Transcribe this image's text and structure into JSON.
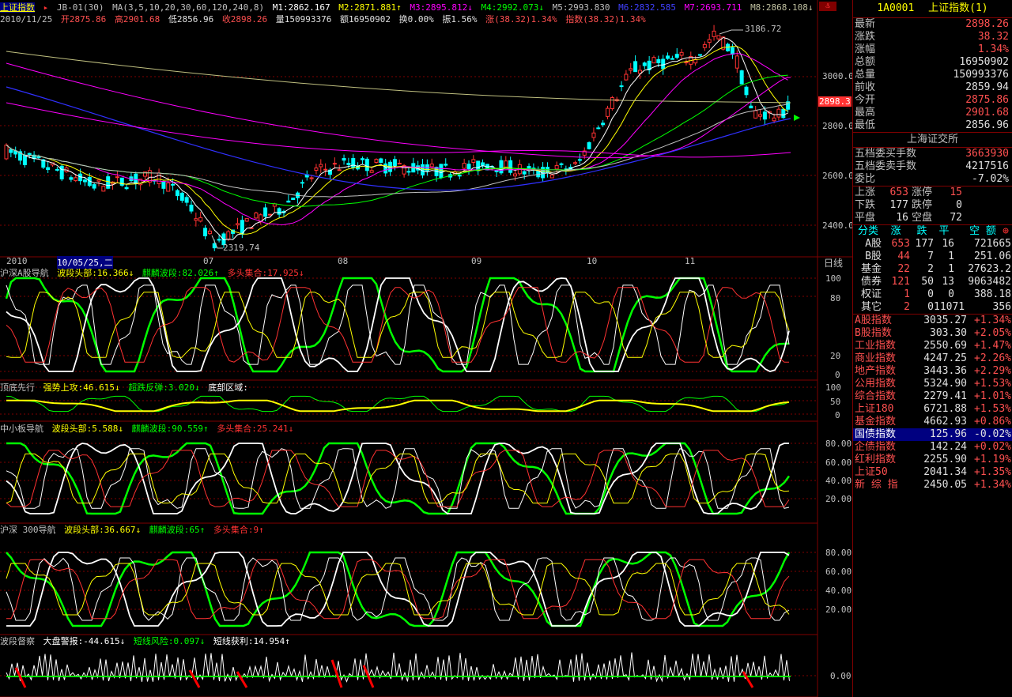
{
  "colors": {
    "up": "#ff3232",
    "down": "#00ffff",
    "ma_white": "#ffffff",
    "ma_yellow": "#ffff00",
    "ma_magenta": "#ff00ff",
    "ma_green": "#00ff00",
    "ma_blue": "#0000ff",
    "grid": "#800000",
    "nav_green": "#00ff00"
  },
  "header": {
    "title": "上证指数",
    "period": "JB-01(30)",
    "ma_label": "MA(3,5,10,20,30,60,120,240,8)",
    "ma_values": [
      "M1:2862.167",
      "M2:2871.881↑",
      "M3:2895.812↓",
      "M4:2992.073↓",
      "M5:2993.830",
      "M6:2832.585",
      "M7:2693.711",
      "M8:2868.108↓"
    ],
    "date": "2010/11/25",
    "open": "开2875.86",
    "high": "高2901.68",
    "low": "低2856.96",
    "close": "收2898.26",
    "volume": "量150993376",
    "amount": "额16950902",
    "turnover": "换0.00%",
    "amplitude": "振1.56%",
    "change": "涨(38.32)1.34%",
    "index_change": "指数(38.32)1.34%"
  },
  "main_chart": {
    "price_labels": [
      "3000.0",
      "2800.0",
      "2600.0",
      "2400.0"
    ],
    "high_label": "3186.72",
    "low_label": "2319.74",
    "current_label": "2898.3",
    "x_labels": [
      "2010",
      "10/05/25,二",
      "07",
      "08",
      "09",
      "10",
      "11"
    ],
    "period_label": "日线"
  },
  "panels": [
    {
      "name": "沪深A股导航",
      "items": [
        {
          "text": "波段头部:16.366↓",
          "color": "#ffff00"
        },
        {
          "text": "麒麟波段:82.026↑",
          "color": "#00ff00"
        },
        {
          "text": "多头集合:17.925↓",
          "color": "#ff3232"
        }
      ],
      "ticks": [
        "100",
        "80",
        "20",
        "0"
      ]
    },
    {
      "name": "顶底先行",
      "items": [
        {
          "text": "强势上攻:46.615↓",
          "color": "#ffff00"
        },
        {
          "text": "超跌反弹:3.020↓",
          "color": "#00ff00"
        },
        {
          "text": "底部区域:",
          "color": "#ffffff"
        }
      ],
      "ticks": [
        "100",
        "50",
        "0"
      ]
    },
    {
      "name": "中小板导航",
      "items": [
        {
          "text": "波段头部:5.588↓",
          "color": "#ffff00"
        },
        {
          "text": "麒麟波段:90.559↑",
          "color": "#00ff00"
        },
        {
          "text": "多头集合:25.241↓",
          "color": "#ff3232"
        }
      ],
      "ticks": [
        "80.00",
        "60.00",
        "40.00",
        "20.00"
      ]
    },
    {
      "name": "沪深 300导航",
      "items": [
        {
          "text": "波段头部:36.667↓",
          "color": "#ffff00"
        },
        {
          "text": "麒麟波段:65↑",
          "color": "#00ff00"
        },
        {
          "text": "多头集合:9↑",
          "color": "#ff3232"
        }
      ],
      "ticks": [
        "80.00",
        "60.00",
        "40.00",
        "20.00"
      ]
    },
    {
      "name": "波段督察",
      "items": [
        {
          "text": "大盘警报:-44.615↓",
          "color": "#ffffff"
        },
        {
          "text": "短线风险:0.097↓",
          "color": "#00ff00"
        },
        {
          "text": "短线获利:14.954↑",
          "color": "#ffffff"
        }
      ],
      "ticks": [
        "0.00"
      ]
    }
  ],
  "quote": {
    "code": "1A0001",
    "name": "上证指数(1)",
    "rows": [
      {
        "label": "最新",
        "value": "2898.26",
        "color": "#ff5050"
      },
      {
        "label": "涨跌",
        "value": "38.32",
        "color": "#ff5050"
      },
      {
        "label": "涨幅",
        "value": "1.34%",
        "color": "#ff5050"
      },
      {
        "label": "总额",
        "value": "16950902",
        "color": "#e0e0e0"
      },
      {
        "label": "总量",
        "value": "150993376",
        "color": "#e0e0e0"
      },
      {
        "label": "前收",
        "value": "2859.94",
        "color": "#e0e0e0"
      },
      {
        "label": "今开",
        "value": "2875.86",
        "color": "#ff5050"
      },
      {
        "label": "最高",
        "value": "2901.68",
        "color": "#ff5050"
      },
      {
        "label": "最低",
        "value": "2856.96",
        "color": "#e0e0e0"
      }
    ],
    "exchange": "上海证交所",
    "order_rows": [
      {
        "label": "五档委买手数",
        "value": "3663930",
        "color": "#ff5050"
      },
      {
        "label": "五档委卖手数",
        "value": "4217516",
        "color": "#e0e0e0"
      },
      {
        "label": "委比",
        "value": "-7.02%",
        "color": "#e0e0e0"
      }
    ],
    "breadth": [
      {
        "l1": "上涨",
        "v1": "653",
        "l2": "涨停",
        "v2": "15"
      },
      {
        "l1": "下跌",
        "v1": "177",
        "l2": "跌停",
        "v2": "0"
      },
      {
        "l1": "平盘",
        "v1": "16",
        "l2": "空盘",
        "v2": "72"
      }
    ],
    "stock_header": [
      "分类",
      "涨",
      "跌",
      "平",
      "空 额"
    ],
    "stocks": [
      {
        "c": "A股",
        "u": "653",
        "d": "177",
        "f": "16",
        "a": "721665"
      },
      {
        "c": "B股",
        "u": "44",
        "d": "7",
        "f": "1",
        "a": "251.06"
      },
      {
        "c": "基金",
        "u": "22",
        "d": "2",
        "f": "1",
        "a": "27623.2"
      },
      {
        "c": "债券",
        "u": "121",
        "d": "50",
        "f": "13",
        "a": "9063482"
      },
      {
        "c": "权证",
        "u": "1",
        "d": "0",
        "f": "0",
        "a": "388.18"
      },
      {
        "c": "其它",
        "u": "2",
        "d": "0",
        "f": "11071",
        "a": "356"
      }
    ],
    "indices": [
      {
        "n": "A股指数",
        "v": "3035.27",
        "p": "+1.34%",
        "color": "#ff5050"
      },
      {
        "n": "B股指数",
        "v": "303.30",
        "p": "+2.05%",
        "color": "#ff5050"
      },
      {
        "n": "工业指数",
        "v": "2550.69",
        "p": "+1.47%",
        "color": "#ff5050"
      },
      {
        "n": "商业指数",
        "v": "4247.25",
        "p": "+2.26%",
        "color": "#ff5050"
      },
      {
        "n": "地产指数",
        "v": "3443.36",
        "p": "+2.29%",
        "color": "#ff5050"
      },
      {
        "n": "公用指数",
        "v": "5324.90",
        "p": "+1.53%",
        "color": "#ff5050"
      },
      {
        "n": "综合指数",
        "v": "2279.41",
        "p": "+1.01%",
        "color": "#ff5050"
      },
      {
        "n": "上证180",
        "v": "6721.88",
        "p": "+1.53%",
        "color": "#ff5050"
      },
      {
        "n": "基金指数",
        "v": "4662.93",
        "p": "+0.86%",
        "color": "#ff5050"
      },
      {
        "n": "国债指数",
        "v": "125.96",
        "p": "-0.02%",
        "color": "#e0e0e0"
      },
      {
        "n": "企债指数",
        "v": "142.24",
        "p": "+0.02%",
        "color": "#ff5050"
      },
      {
        "n": "红利指数",
        "v": "2255.90",
        "p": "+1.19%",
        "color": "#ff5050"
      },
      {
        "n": "上证50",
        "v": "2041.34",
        "p": "+1.35%",
        "color": "#ff5050"
      },
      {
        "n": "新 综 指",
        "v": "2450.05",
        "p": "+1.34%",
        "color": "#ff5050"
      }
    ]
  }
}
